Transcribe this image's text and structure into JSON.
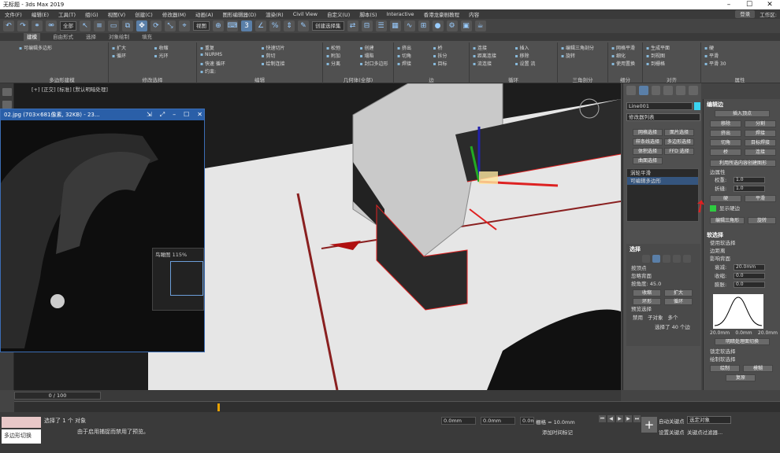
{
  "title": "无标题 - 3ds Max 2019",
  "menu": [
    "文件(F)",
    "编辑(E)",
    "工具(T)",
    "组(G)",
    "视图(V)",
    "创建(C)",
    "修改器(M)",
    "动画(A)",
    "图形编辑器(D)",
    "渲染(R)",
    "Civil View",
    "自定义(U)",
    "脚本(S)",
    "Interactive",
    "香港龙豪剧教程",
    "内容"
  ],
  "login": "登录",
  "workspace": "工作区:",
  "toolbar": {
    "selection_filter": "全部",
    "coord": "视图",
    "selection_set": "创建选择集"
  },
  "ribbon_tabs": [
    "建模",
    "自由形式",
    "选择",
    "对象绘制",
    "填充"
  ],
  "ribbon": {
    "g1_label": "多边形建模",
    "g1_item": "可编辑多边形",
    "g2_label": "修改选择",
    "g2_items": [
      "扩大",
      "收缩",
      "循环",
      "光环"
    ],
    "g3_label": "编辑",
    "g3_items": [
      "重复",
      "快速切片",
      "NURMS",
      "剪切",
      "快速 循环",
      "绘制连接",
      "约束:"
    ],
    "g4_label": "几何体(全部)",
    "g4_items": [
      "松弛",
      "创建",
      "附加",
      "塌陷",
      "分离",
      "封口多边形"
    ],
    "g5_label": "边",
    "g5_items": [
      "挤出",
      "桥",
      "切角",
      "拆分",
      "焊接",
      "目标"
    ],
    "g6_label": "循环",
    "g6_items": [
      "连接",
      "插入",
      "距离连接",
      "移除",
      "流连接",
      "设置 流"
    ],
    "g7_label": "三角剖分",
    "g7_items": [
      "编辑三角剖分",
      "旋转"
    ],
    "g8_label": "细分",
    "g8_items": [
      "网格平滑",
      "细化",
      "使用置换"
    ],
    "g9_label": "对齐",
    "g9_items": [
      "生成平面",
      "到视图",
      "到栅格"
    ],
    "g10_label": "属性",
    "g10_items": [
      "硬",
      "平滑",
      "平滑 30"
    ]
  },
  "viewport_label": "[+] [正交] [标准] [默认明暗处理]",
  "frame": "0 / 100",
  "image_window": {
    "title": "02.jpg (703×681像素, 32KB) - 23...",
    "nav_title": "鸟瞰图 115%"
  },
  "command_panel": {
    "object_name": "Line001",
    "color": "#3ad3f0",
    "modifier_list": "修改器列表",
    "buttons": [
      "网格选择",
      "面片选择",
      "样条线选择",
      "多边形选择",
      "体积选择",
      "FFD 选择",
      "曲面选择"
    ],
    "stack": [
      "涡轮平滑",
      "可编辑多边形"
    ],
    "selection_header": "选择",
    "by_vertex": "按顶点",
    "ignore_back": "忽略背面",
    "angle_label": "按角度:",
    "angle_value": "45.0",
    "shrink": "收缩",
    "grow": "扩大",
    "ring": "环形",
    "loop": "循环",
    "preview": "预览选择",
    "disable": "禁用",
    "subobj": "子对象",
    "multi": "多个",
    "selected": "选择了 40 个边"
  },
  "right_panel": {
    "header": "编辑边",
    "insert_vertex": "插入顶点",
    "remove": "移除",
    "split": "分割",
    "extrude": "挤出",
    "weld": "焊接",
    "chamfer": "切角",
    "target_weld": "目标焊接",
    "bridge": "桥",
    "connect": "连接",
    "create_shape": "利用所选内容创建图形",
    "edge_props": "边属性",
    "weight_label": "权重:",
    "weight_value": "1.0",
    "crease_label": "折缝:",
    "crease_value": "1.0",
    "hard": "硬",
    "smooth": "平滑",
    "display_hard": "显示硬边",
    "edit_tri": "编辑三角形",
    "rotate": "旋转",
    "soft_header": "软选择",
    "use_soft": "使用软选择",
    "edge_dist": "边距离",
    "affect_back": "影响背面",
    "falloff": "衰减:",
    "falloff_v": "20.0mm",
    "pinch": "收缩:",
    "pinch_v": "0.0",
    "bubble": "膨胀:",
    "bubble_v": "0.0",
    "curve_l": "20.0mm",
    "curve_m": "0.0mm",
    "curve_r": "20.0mm",
    "shaded_face": "明暗处理面切换",
    "lock_soft": "锁定软选择",
    "paint_soft": "绘制软选择",
    "paint": "绘制",
    "blur": "模糊",
    "revert": "复原"
  },
  "status": {
    "selected": "选择了 1 个 对象",
    "hint": "由于启用捕捉而禁用了预览。",
    "mode": "多边形切换",
    "x": "0.0mm",
    "y": "0.0mm",
    "z": "0.0mm",
    "grid": "栅格 = 10.0mm",
    "add_key": "添加时间标记",
    "auto_key": "自动关键点",
    "set_key": "设置关键点",
    "sel_obj": "选定对象",
    "key_filter": "关键点过滤器..."
  }
}
